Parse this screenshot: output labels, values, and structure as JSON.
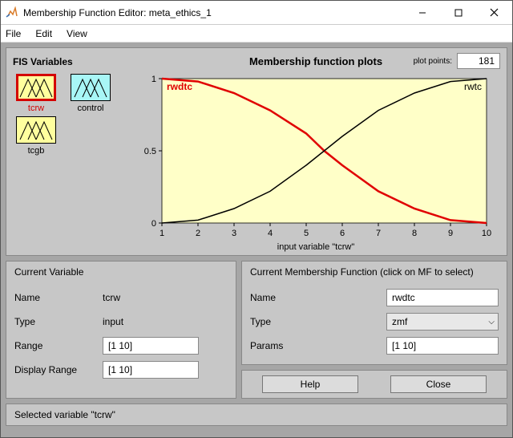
{
  "window": {
    "title": "Membership Function Editor: meta_ethics_1"
  },
  "menu": {
    "file": "File",
    "edit": "Edit",
    "view": "View"
  },
  "fis": {
    "header": "FIS Variables",
    "vars": [
      {
        "label": "tcrw",
        "selected": true,
        "output": false
      },
      {
        "label": "control",
        "selected": false,
        "output": true
      },
      {
        "label": "tcgb",
        "selected": false,
        "output": false
      }
    ]
  },
  "plot": {
    "title": "Membership function plots",
    "points_label": "plot points:",
    "points_value": "181",
    "mf_labels": {
      "left": "rwdtc",
      "right": "rwtc"
    },
    "xaxis": "input variable \"tcrw\""
  },
  "chart_data": {
    "type": "line",
    "xlabel": "input variable \"tcrw\"",
    "ylabel": "",
    "xlim": [
      1,
      10
    ],
    "ylim": [
      0,
      1
    ],
    "xticks": [
      1,
      2,
      3,
      4,
      5,
      6,
      7,
      8,
      9,
      10
    ],
    "yticks": [
      0,
      0.5,
      1
    ],
    "series": [
      {
        "name": "rwdtc",
        "color": "#e00000",
        "type": "zmf",
        "params": [
          1,
          10
        ],
        "x": [
          1,
          2,
          3,
          4,
          5,
          5.5,
          6,
          7,
          8,
          9,
          10
        ],
        "y": [
          1.0,
          0.98,
          0.9,
          0.78,
          0.62,
          0.5,
          0.4,
          0.22,
          0.1,
          0.02,
          0.0
        ]
      },
      {
        "name": "rwtc",
        "color": "#000000",
        "type": "smf",
        "params": [
          1,
          10
        ],
        "x": [
          1,
          2,
          3,
          4,
          5,
          5.5,
          6,
          7,
          8,
          9,
          10
        ],
        "y": [
          0.0,
          0.02,
          0.1,
          0.22,
          0.4,
          0.5,
          0.6,
          0.78,
          0.9,
          0.98,
          1.0
        ]
      }
    ]
  },
  "current_variable": {
    "title": "Current Variable",
    "name_label": "Name",
    "name_value": "tcrw",
    "type_label": "Type",
    "type_value": "input",
    "range_label": "Range",
    "range_value": "[1 10]",
    "drange_label": "Display Range",
    "drange_value": "[1 10]"
  },
  "current_mf": {
    "title": "Current Membership Function (click on MF to select)",
    "name_label": "Name",
    "name_value": "rwdtc",
    "type_label": "Type",
    "type_value": "zmf",
    "params_label": "Params",
    "params_value": "[1 10]"
  },
  "buttons": {
    "help": "Help",
    "close": "Close"
  },
  "status": "Selected variable \"tcrw\""
}
